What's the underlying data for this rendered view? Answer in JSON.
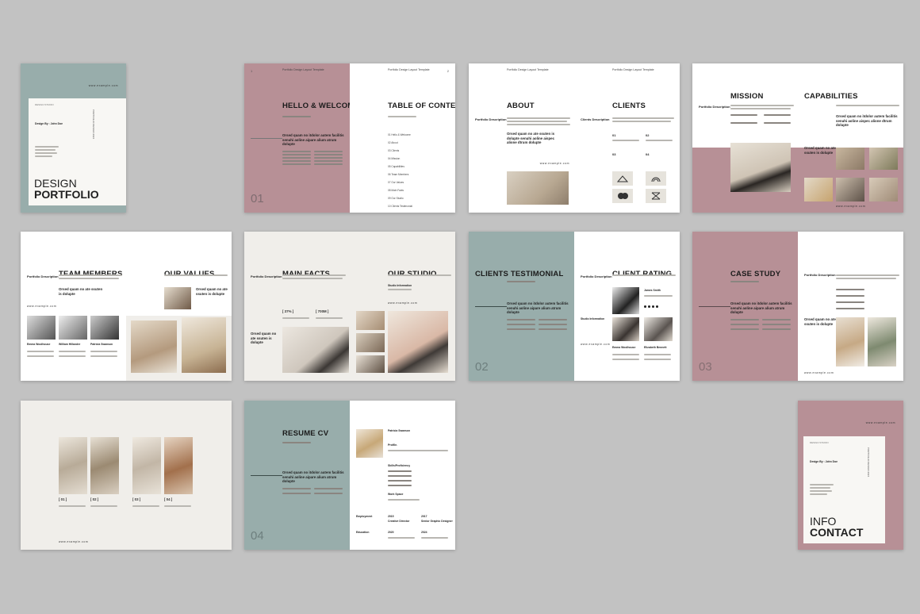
{
  "cover": {
    "title_line1": "DESIGN",
    "title_line2": "PORTFOLIO",
    "web": "www.example.com",
    "design_by": "Design By : John Doe",
    "studio": "DESIGN STUDIO",
    "vertical": "PORTFOLIO DESIGN 2024",
    "colors": {
      "bg": "#98adab"
    }
  },
  "welcome": {
    "page_left": "1",
    "page_right": "2",
    "header": "Portfolio Design Layout Template",
    "title_left": "HELLO & WELCOME",
    "title_right": "TABLE OF CONTENT",
    "quote": "Orsed quam no itdolor autem facilitis senuhi aoline aipare alium atrum dolupte",
    "big": "01",
    "toc": [
      "01 Hello & Welcome",
      "02 About",
      "03 Clients",
      "04 Mission",
      "05 Capabilities",
      "06 Team Members",
      "07 Our Values",
      "08 Main Facts",
      "09 Our Studio",
      "10 Clients Testimonial"
    ]
  },
  "about": {
    "title_left": "ABOUT",
    "title_right": "CLIENTS",
    "label": "Portfolio Description",
    "label_r": "Clients Description",
    "quote": "Orsed quam no ate ssuten is dolupte senuhi aoline aispec alione dtrum dolupte",
    "web": "www.example.com",
    "n1": "01",
    "n2": "02",
    "n3": "03",
    "n4": "04"
  },
  "mission": {
    "title_left": "MISSION",
    "title_right": "CAPABILITIES",
    "label": "Portfolio Description",
    "quote": "Orsed quam no itdolor autem facilitis senuhi aoline aispec alione dtrum dolupte",
    "quote2": "Orsed quam no ate ssuten is dolupte",
    "web": "www.example.com"
  },
  "team": {
    "title_left": "TEAM MEMBERS",
    "title_right": "OUR VALUES",
    "label": "Portfolio Description",
    "quote": "Orsed quam no ate ssuten is dolupte",
    "quote_r": "Orsed quam no ate ssuten is dolupte",
    "web": "www.example.com",
    "members": [
      "Emma Woolhouse",
      "William Hillander",
      "Patricia Swanson"
    ]
  },
  "facts": {
    "title_left": "MAIN FACTS",
    "title_right": "OUR STUDIO",
    "label": "Portfolio Description",
    "quote": "Orsed quam no ate ssuten is dolupte",
    "b1": "[ 37% ]",
    "b2": "[ 700M ]",
    "studio_info": "Studio Information",
    "web": "www.example.com"
  },
  "testimonial": {
    "title_left": "CLIENTS TESTIMONIAL",
    "title_right": "CLIENT RATING",
    "label": "Portfolio Description",
    "quote": "Orsed quam no itdolor autem facilitis senuhi aoline aipare alium atrum dolupte",
    "big": "02",
    "name1": "James Smith",
    "name2": "Emma Woolhouse",
    "name3": "Elizabeth Bennett",
    "studio": "Studio Information",
    "web": "www.example.com"
  },
  "case": {
    "title_left": "CASE STUDY",
    "label": "Portfolio Description",
    "quote": "Orsed quam no itdolor autem facilitis senuhi aoline aipare alium atrum dolupte",
    "quote2": "Orsed quam no ate ssuten is dolupte",
    "big": "03",
    "web": "www.example.com"
  },
  "gallery": {
    "b1": "[ 01 ]",
    "b2": "[ 02 ]",
    "b3": "[ 03 ]",
    "b4": "[ 04 ]",
    "web": "www.example.com"
  },
  "resume": {
    "title": "RESUME CV",
    "quote": "Orsed quam no itdolor autem facilitis senuhi aoline aipare alium atrum dolupte",
    "big": "04",
    "name": "Patricia Swanson",
    "profile": "Profile.",
    "skills": "Skills/Proficiency",
    "work": "Work Space",
    "employment": "Employment",
    "education": "Education",
    "y1": "2015",
    "y2": "2017",
    "y3": "2020",
    "y4": "2024",
    "job1": "Creative Director",
    "job2": "Senior Graphic Designer",
    "web": "www.example.com"
  },
  "contact": {
    "title_line1": "INFO",
    "title_line2": "CONTACT",
    "web": "www.example.com",
    "design_by": "Design By : John Doe",
    "studio": "DESIGN STUDIO",
    "vertical": "PORTFOLIO DESIGN 2024",
    "colors": {
      "bg": "#b79096"
    }
  }
}
